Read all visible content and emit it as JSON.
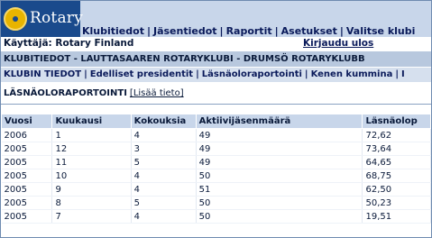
{
  "header": {
    "logo_text": "Rotary",
    "nav": [
      "Klubitiedot",
      "Jäsentiedot",
      "Raportit",
      "Asetukset",
      "Valitse klubi"
    ]
  },
  "userbar": {
    "user": "Käyttäjä: Rotary Finland",
    "logout": "Kirjaudu ulos"
  },
  "club_title": "KLUBITIEDOT - LAUTTASAAREN ROTARYKLUBI - DRUMSÖ ROTARYKLUBB",
  "subnav": [
    "KLUBIN TIEDOT",
    "Edelliset presidentit",
    "Läsnäoloraportointi",
    "Kenen kummina",
    "I"
  ],
  "section": {
    "title": "LÄSNÄOLORAPORTOINTI",
    "add_link": "[Lisää tieto]"
  },
  "table": {
    "headers": [
      "Vuosi",
      "Kuukausi",
      "Kokouksia",
      "Aktiivijäsenmäärä",
      "Läsnäolop"
    ],
    "rows": [
      [
        "2006",
        "1",
        "4",
        "49",
        "72,62"
      ],
      [
        "2005",
        "12",
        "3",
        "49",
        "73,64"
      ],
      [
        "2005",
        "11",
        "5",
        "49",
        "64,65"
      ],
      [
        "2005",
        "10",
        "4",
        "50",
        "68,75"
      ],
      [
        "2005",
        "9",
        "4",
        "51",
        "62,50"
      ],
      [
        "2005",
        "8",
        "5",
        "50",
        "50,23"
      ],
      [
        "2005",
        "7",
        "4",
        "50",
        "19,51"
      ]
    ]
  }
}
